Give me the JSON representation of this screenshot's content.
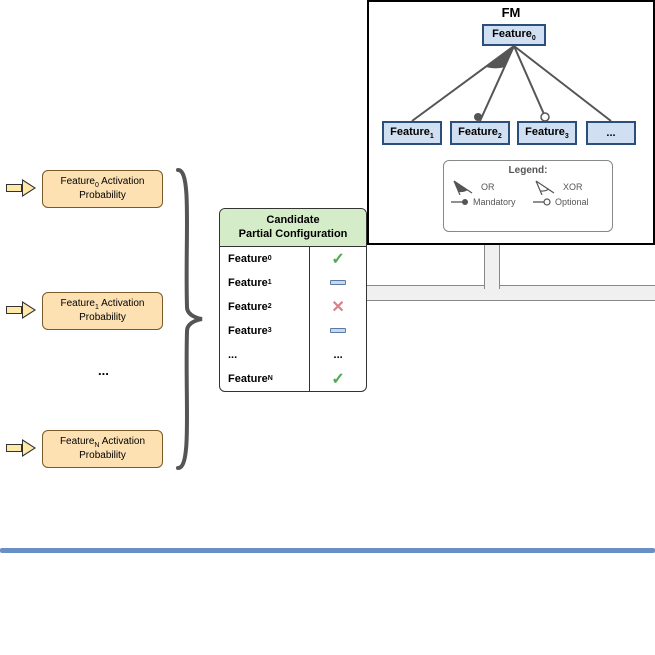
{
  "prob": {
    "p0_line1": "Feature",
    "p0_sub": "0",
    "p0_suffix": " Activation",
    "p0_line2": "Probability",
    "p1_line1": "Feature",
    "p1_sub": "1",
    "p1_suffix": " Activation",
    "p1_line2": "Probability",
    "pn_line1": "Feature",
    "pn_sub": "N",
    "pn_suffix": " Activation",
    "pn_line2": "Probability",
    "ellipsis": "..."
  },
  "config": {
    "title_l1": "Candidate",
    "title_l2": "Partial Configuration",
    "rows": {
      "r0": "Feature",
      "r0s": "0",
      "r1": "Feature",
      "r1s": "1",
      "r2": "Feature",
      "r2s": "2",
      "r3": "Feature",
      "r3s": "3",
      "r4": "...",
      "r5": "Feature",
      "r5s": "N",
      "s0": "✓",
      "s2": "✕",
      "s4": "...",
      "s5": "✓"
    }
  },
  "fm": {
    "title": "FM",
    "root": "Feature",
    "root_sub": "0",
    "f1": "Feature",
    "f1s": "1",
    "f2": "Feature",
    "f2s": "2",
    "f3": "Feature",
    "f3s": "3",
    "f4": "..."
  },
  "legend": {
    "title": "Legend:",
    "or": "OR",
    "xor": "XOR",
    "mandatory": "Mandatory",
    "optional": "Optional"
  }
}
